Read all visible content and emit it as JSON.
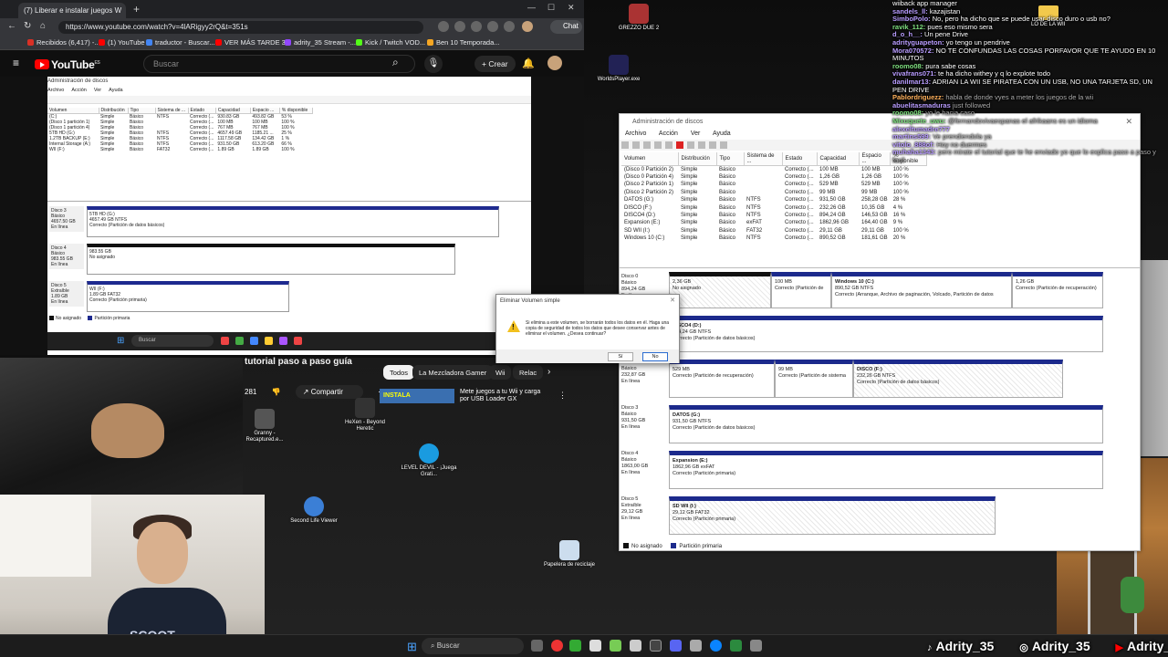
{
  "browser": {
    "tab_title": "(7) Liberar e instalar juegos W",
    "url": "https://www.youtube.com/watch?v=4lARigyy2rQ&t=351s",
    "chat_label": "Chat",
    "bookmarks": [
      {
        "label": "Recibidos (6,417) -...",
        "color": "#d93025"
      },
      {
        "label": "(1) YouTube",
        "color": "#ff0000"
      },
      {
        "label": "traductor - Buscar...",
        "color": "#4285f4"
      },
      {
        "label": "VER MÁS TARDE 3...",
        "color": "#ff0000"
      },
      {
        "label": "adrity_35 Stream -...",
        "color": "#9146ff"
      },
      {
        "label": "Kick / Twitch VOD...",
        "color": "#53fc18"
      },
      {
        "label": "Ben 10 Temporada...",
        "color": "#f5a623"
      }
    ]
  },
  "youtube": {
    "logo": "YouTube",
    "logo_sup": "ES",
    "search_placeholder": "Buscar",
    "create_label": "Crear",
    "bell_badge": "",
    "video_title": "tutorial paso a paso guía",
    "chips": [
      "Todos",
      "La Mezcladora Gamer",
      "Wii",
      "Relac"
    ],
    "likes": "281",
    "share_label": "Compartir",
    "rec_title": "Mete juegos a tu Wii y carga por USB Loader GX",
    "rec_thumb_text": "INSTALA"
  },
  "video_dm": {
    "title": "Administración de discos",
    "menu": [
      "Archivo",
      "Acción",
      "Ver",
      "Ayuda"
    ],
    "columns": [
      "Volumen",
      "Distribución",
      "Tipo",
      "Sistema de ...",
      "Estado",
      "Capacidad",
      "Espacio ...",
      "% disponible"
    ],
    "rows": [
      [
        "(C:)",
        "Simple",
        "Básico",
        "NTFS",
        "Correcto (...",
        "930.83 GB",
        "493.82 GB",
        "53 %"
      ],
      [
        "(Disco 1 partición 1)",
        "Simple",
        "Básico",
        "",
        "Correcto (...",
        "100 MB",
        "100 MB",
        "100 %"
      ],
      [
        "(Disco 1 partición 4)",
        "Simple",
        "Básico",
        "",
        "Correcto (...",
        "767 MB",
        "767 MB",
        "100 %"
      ],
      [
        "5TB HD (G:)",
        "Simple",
        "Básico",
        "NTFS",
        "Correcto (...",
        "4657.49 GB",
        "1185.21 ...",
        "25 %"
      ],
      [
        "1.2TB BACKUP (E:)",
        "Simple",
        "Básico",
        "NTFS",
        "Correcto (...",
        "1117.58 GB",
        "134.42 GB",
        "1 %"
      ],
      [
        "Internal Storage (A:)",
        "Simple",
        "Básico",
        "NTFS",
        "Correcto (...",
        "931.50 GB",
        "613.20 GB",
        "66 %"
      ],
      [
        "WII (F:)",
        "Simple",
        "Básico",
        "FAT32",
        "Correcto (...",
        "1.89 GB",
        "1.89 GB",
        "100 %"
      ]
    ],
    "disk3": {
      "label": "Disco 3\nBásico\n4657.50 GB\nEn línea",
      "vol": "5TB HD (G:)\n4657.49 GB NTFS\nCorrecto (Partición de datos básicos)"
    },
    "disk4": {
      "label": "Disco 4\nBásico\n983.55 GB\nEn línea",
      "vol": "983.55 GB\nNo asignado"
    },
    "disk5": {
      "label": "Disco 5\nExtraíble\n1.89 GB\nEn línea",
      "vol": "WII (F:)\n1.89 GB FAT32\nCorrecto (Partición primaria)"
    },
    "legend": [
      "No asignado",
      "Partición primaria"
    ]
  },
  "dialog": {
    "title": "Eliminar Volumen simple",
    "message": "Si elimina a este volumen, se borrarán todos los datos en él. Haga una copia de seguridad de todos los datos que desee conservar antes de eliminar el volumen. ¿Desea continuar?",
    "yes": "Sí",
    "no": "No"
  },
  "disk_manager": {
    "title": "Administración de discos",
    "menu": [
      "Archivo",
      "Acción",
      "Ver",
      "Ayuda"
    ],
    "columns": [
      "Volumen",
      "Distribución",
      "Tipo",
      "Sistema de ...",
      "Estado",
      "Capacidad",
      "Espacio ...",
      "% disponible"
    ],
    "rows": [
      [
        "(Disco 0 Partición 2)",
        "Simple",
        "Básico",
        "",
        "Correcto (...",
        "100 MB",
        "100 MB",
        "100 %"
      ],
      [
        "(Disco 0 Partición 4)",
        "Simple",
        "Básico",
        "",
        "Correcto (...",
        "1,26 GB",
        "1,26 GB",
        "100 %"
      ],
      [
        "(Disco 2 Partición 1)",
        "Simple",
        "Básico",
        "",
        "Correcto (...",
        "529 MB",
        "529 MB",
        "100 %"
      ],
      [
        "(Disco 2 Partición 2)",
        "Simple",
        "Básico",
        "",
        "Correcto (...",
        "99 MB",
        "99 MB",
        "100 %"
      ],
      [
        "DATOS (G:)",
        "Simple",
        "Básico",
        "NTFS",
        "Correcto (...",
        "931,50 GB",
        "258,28 GB",
        "28 %"
      ],
      [
        "DISCO (F:)",
        "Simple",
        "Básico",
        "NTFS",
        "Correcto (...",
        "232,26 GB",
        "10,35 GB",
        "4 %"
      ],
      [
        "DISCO4 (D:)",
        "Simple",
        "Básico",
        "NTFS",
        "Correcto (...",
        "894,24 GB",
        "146,53 GB",
        "16 %"
      ],
      [
        "Expansion (E:)",
        "Simple",
        "Básico",
        "exFAT",
        "Correcto (...",
        "1862,96 GB",
        "164,40 GB",
        "9 %"
      ],
      [
        "SD WII (I:)",
        "Simple",
        "Básico",
        "FAT32",
        "Correcto (...",
        "29,11 GB",
        "29,11 GB",
        "100 %"
      ],
      [
        "Windows 10 (C:)",
        "Simple",
        "Básico",
        "NTFS",
        "Correcto (...",
        "890,52 GB",
        "181,61 GB",
        "20 %"
      ]
    ],
    "disks": {
      "d0": {
        "label": "Disco 0\nBásico\n894,24 GB\nEn línea",
        "v1": "2,36 GB\nNo asignado",
        "v2": "100 MB\nCorrecto (Partición de",
        "v3_name": "Windows 10 (C:)",
        "v3": "890,52 GB NTFS\nCorrecto (Arranque, Archivo de paginación, Volcado, Partición de datos",
        "v4": "1,26 GB\nCorrecto (Partición de recuperación)"
      },
      "d1": {
        "label": "",
        "v1_name": "DISCO4 (D:)",
        "v1": "894,24 GB NTFS\nCorrecto (Partición de datos básicos)"
      },
      "d2": {
        "label": "Disco 2\nBásico\n232,87 GB\nEn línea",
        "v1": "529 MB\nCorrecto (Partición de recuperación)",
        "v2": "99 MB\nCorrecto (Partición de sistema",
        "v3_name": "DISCO (F:)",
        "v3": "232,26 GB NTFS\nCorrecto (Partición de datos básicos)"
      },
      "d3": {
        "label": "Disco 3\nBásico\n931,50 GB\nEn línea",
        "v1_name": "DATOS (G:)",
        "v1": "931,50 GB NTFS\nCorrecto (Partición de datos básicos)"
      },
      "d4": {
        "label": "Disco 4\nBásico\n1863,00 GB\nEn línea",
        "v1_name": "Expansion (E:)",
        "v1": "1862,96 GB exFAT\nCorrecto (Partición primaria)"
      },
      "d5": {
        "label": "Disco 5\nExtraíble\n29,12 GB\nEn línea",
        "v1_name": "SD WII (I:)",
        "v1": "29,12 GB FAT32\nCorrecto (Partición primaria)"
      }
    },
    "legend": [
      "No asignado",
      "Partición primaria"
    ]
  },
  "chat": [
    {
      "user": "",
      "text": "wiiback app manager",
      "color": "plain"
    },
    {
      "user": "sandels_ll:",
      "text": "kazajistan",
      "color": "purple"
    },
    {
      "user": "SimboPolo:",
      "text": "No, pero ha dicho que se puede usar disco duro o usb no?",
      "color": "purple"
    },
    {
      "user": "ravik_112:",
      "text": "pues eso mismo sera",
      "color": "green"
    },
    {
      "user": "d_o_h__:",
      "text": "Un pene Drive",
      "color": "purple"
    },
    {
      "user": "adrityguapeton:",
      "text": "yo tengo un pendrive",
      "color": "purple"
    },
    {
      "user": "Mora070572:",
      "text": "NO TE CONFUNDAS LAS COSAS PORFAVOR QUE TE AYUDO EN 10 MINUTOS",
      "color": "purple"
    },
    {
      "user": "roomo08:",
      "text": "pura sabe cosas",
      "color": "green"
    },
    {
      "user": "vivafrans071:",
      "text": "te ha dicho withey y q lo explote todo",
      "color": "purple"
    },
    {
      "user": "danilmar13:",
      "text": "ADRIAN LA WII SE PIRATEA CON UN USB, NO UNA TARJETA SD, UN PEN DRIVE",
      "color": "purple"
    },
    {
      "user": "Pablordriguezz:",
      "text": "habla de donde vyes a meter los juegos de la wii",
      "color": "orange"
    },
    {
      "user": "abuelitasmaduras",
      "text": "just followed",
      "color": "purple"
    },
    {
      "user": "roomo08:",
      "text": "yo le hacia caso",
      "color": "green"
    },
    {
      "user": "Mixuquete_uwu:",
      "text": "@fernandovivaespanas el afrikaans es un idioma",
      "color": "green"
    },
    {
      "user": "alexeltumadre777",
      "text": "",
      "color": "purple"
    },
    {
      "user": "martins599:",
      "text": "Ve prendiendola ya",
      "color": "purple"
    },
    {
      "user": "vitolo_888of:",
      "text": "Hoy no duermes",
      "color": "purple"
    },
    {
      "user": "muhaha1343:",
      "text": "pero mirate el tutorial que te he enviado yo que lo explica paso a paso y facil",
      "color": "purple"
    }
  ],
  "desktop": {
    "icons": {
      "grezzo": "GREZZO DUE 2",
      "worlds": "WorldsPlayer.exe",
      "hexen": "HeXen - Beyond Heretic",
      "granny": "Granny - Recaptured.e...",
      "edge": "LEVEL DEVIL - ¡Juega Grati...",
      "secondlife": "Second Life Viewer",
      "recycle": "Papelera de reciclaje",
      "wiifolder": "LO DE LA WII"
    },
    "taskbar_search": "Buscar",
    "shirt_text": "SCOOT"
  },
  "social": {
    "tiktok": "Adrity_35",
    "instagram": "Adrity_35",
    "youtube": "Adrity_35"
  }
}
